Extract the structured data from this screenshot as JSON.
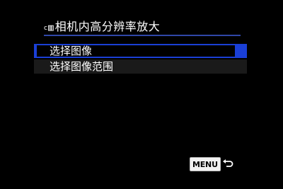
{
  "header": {
    "title_icon_camera": "c",
    "title_icon_bars": "▥",
    "title": "相机内高分辨率放大"
  },
  "menu": {
    "items": [
      {
        "label": "选择图像",
        "selected": true
      },
      {
        "label": "选择图像范围",
        "selected": false
      }
    ]
  },
  "footer": {
    "menu_button_label": "MENU",
    "back_icon": "return-arrow-icon"
  },
  "colors": {
    "background": "#000000",
    "accent": "#1a3fd6",
    "rule": "#2f47a8",
    "text": "#ffffff"
  }
}
